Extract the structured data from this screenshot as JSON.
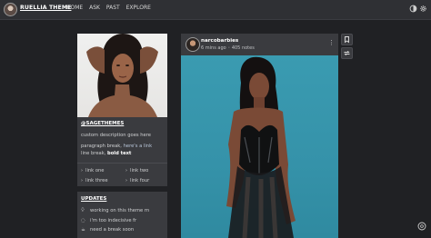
{
  "topbar": {
    "brand": "RUELLIA THEME",
    "nav": [
      "HOME",
      "ASK",
      "PAST",
      "EXPLORE"
    ],
    "icons": [
      "contrast-icon",
      "settings-icon"
    ]
  },
  "sidebar": {
    "handle": "@SAGETHEMES",
    "description": "custom description goes here",
    "line_para_prefix": "paragraph break,",
    "line_para_link": "here's a link",
    "line_break_prefix": "line break,",
    "line_break_bold": "bold text",
    "links": [
      "link one",
      "link two",
      "link three",
      "link four"
    ],
    "updates_title": "UPDATES",
    "updates": [
      {
        "icon": "lightbulb-icon",
        "text": "working on this theme rn"
      },
      {
        "icon": "chat-bubble-icon",
        "text": "i'm too indecisive fr"
      },
      {
        "icon": "coffee-icon",
        "text": "need a break soon"
      }
    ]
  },
  "post": {
    "username": "narcobarbies",
    "meta": "6 mins ago  ◦  405 notes",
    "menu": "⋮"
  },
  "side_buttons": [
    "bookmark-icon",
    "reblog-icon"
  ],
  "colors": {
    "background": "#202124",
    "panel": "#3a3b3f",
    "topbar": "#2f3034",
    "post_image_bg": "#3592a9"
  }
}
